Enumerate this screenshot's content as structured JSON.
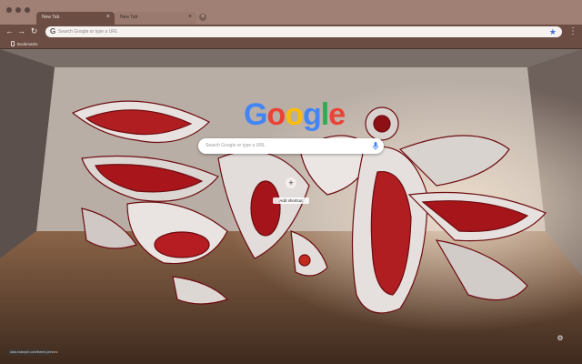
{
  "tabs": [
    {
      "title": "New Tab",
      "active": true
    },
    {
      "title": "New Tab",
      "active": false
    }
  ],
  "toolbar": {
    "back_icon": "back-arrow-icon",
    "forward_icon": "forward-arrow-icon",
    "reload_icon": "reload-icon",
    "omnibox_placeholder": "Search Google or type a URL",
    "bookmark_icon": "star-icon",
    "menu_icon": "kebab-menu-icon"
  },
  "bookmarks_bar": {
    "items": [
      {
        "label": "Bookmarks",
        "icon": "bookmark-folder-icon"
      }
    ]
  },
  "ntp": {
    "logo_letters": [
      "G",
      "o",
      "o",
      "g",
      "l",
      "e"
    ],
    "logo_colors": [
      "#4285F4",
      "#EA4335",
      "#FBBC05",
      "#4285F4",
      "#34A853",
      "#EA4335"
    ],
    "search_placeholder": "Search Google or type a URL",
    "shortcut_label": "Add shortcut",
    "customize_icon": "gear-icon"
  },
  "status": {
    "text": "data.example.com/theme-preview"
  },
  "colors": {
    "frame": "#a07f74",
    "toolbar": "#6b4d43",
    "accent_red": "#b01e22"
  }
}
